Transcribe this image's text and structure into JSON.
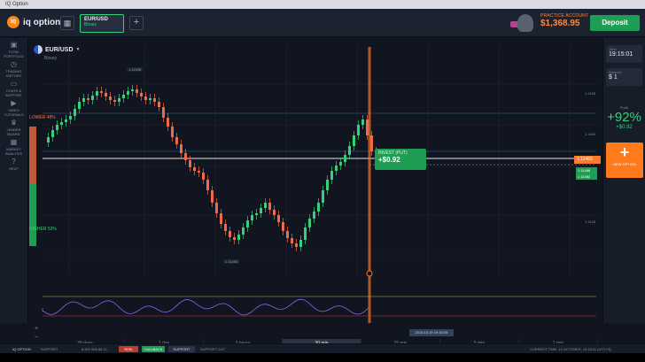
{
  "window": {
    "title": "IQ Option"
  },
  "brand": {
    "logo_mark": "iq",
    "name": "iq option"
  },
  "header": {
    "tab": {
      "asset": "EUR/USD",
      "type": "Binary"
    },
    "account": {
      "label": "PRACTICE ACCOUNT",
      "balance": "$1,368.95"
    },
    "deposit_label": "Deposit"
  },
  "nav": [
    {
      "icon": "briefcase-icon",
      "glyph": "▣",
      "label": "TOTAL PORTFOLIO"
    },
    {
      "icon": "clock-icon",
      "glyph": "◷",
      "label": "TRADING HISTORY"
    },
    {
      "icon": "chat-icon",
      "glyph": "▭",
      "label": "CHATS & SUPPORT"
    },
    {
      "icon": "video-icon",
      "glyph": "▶",
      "label": "VIDEO TUTORIALS"
    },
    {
      "icon": "trophy-icon",
      "glyph": "♛",
      "label": "LEADER BOARD"
    },
    {
      "icon": "calendar-icon",
      "glyph": "▦",
      "label": "MARKET ANALYSIS"
    },
    {
      "icon": "question-icon",
      "glyph": "?",
      "label": "HELP"
    }
  ],
  "chart": {
    "pair": "EUR/USD",
    "type": "Binary",
    "sentiment": {
      "higher": "HIGHER  52%",
      "lower": "LOWER  48%"
    },
    "high_label": "1.11528",
    "low_label": "1.11495",
    "deal": {
      "label": "INVEST (PUT)",
      "value": "+$0.92"
    },
    "price_tag": "1.11483",
    "tag_a": "1.11486",
    "tag_b": "1.11482",
    "axis": [
      "1.1155",
      "1.1150",
      "1.1145"
    ],
    "time_tag": "2016.10.19 19:15:09",
    "colors": {
      "up": "#36d07a",
      "down": "#ef6a4a",
      "line": "#ff7a2a"
    }
  },
  "timescale": [
    "30 days",
    "1 day",
    "3 hours",
    "30 min",
    "15 min",
    "5 min",
    "1 min"
  ],
  "timescale_active": 3,
  "right": {
    "time_label": "Time",
    "time_value": "19:15:01",
    "amount_label": "Amount",
    "amount_value": "$ 1",
    "payout_label": "Profit",
    "payout_pct": "+92%",
    "payout_amt": "+$0.92",
    "new_option": "NEW OPTION"
  },
  "bottom": {
    "brand": "IQ OPTION",
    "support": "SUPPORT",
    "phone": "8 800 555 88 21",
    "btn_red": "RISK",
    "btn_green": "CALLBACK",
    "btn_gray": "SUPPORT",
    "extra": "SUPPORT 24/7",
    "time": "CURRENT TIME: 19 OCTOBER, 19:15:11 (UTC+3)"
  }
}
